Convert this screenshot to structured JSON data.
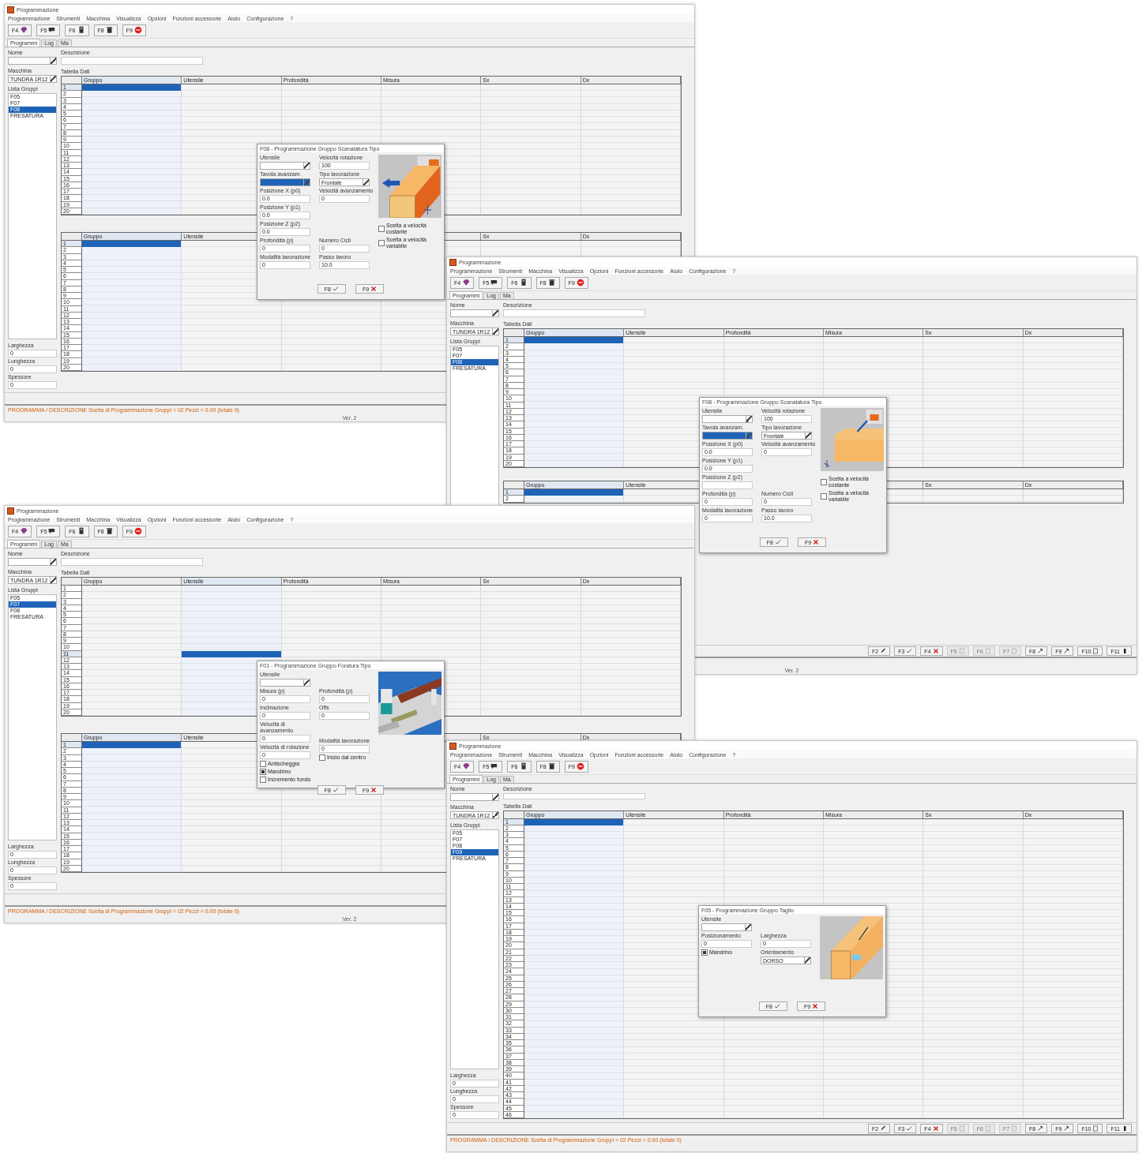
{
  "windows": [
    {
      "title": "Programmazione",
      "menu": [
        "Programmazione",
        "Strumenti",
        "Macchina",
        "Visualizza",
        "Opzioni",
        "Funzioni accessorie",
        "Aiuto",
        "Configurazione",
        "?"
      ],
      "toolbar": [
        {
          "key": "F4",
          "kind": "gem"
        },
        {
          "key": "F5",
          "kind": "chat"
        },
        {
          "key": "F6",
          "kind": "device"
        },
        {
          "key": "F8",
          "kind": "trash"
        },
        {
          "key": "F9",
          "kind": "stop"
        }
      ],
      "tabs": [
        {
          "label": "Programmi",
          "selected": true
        },
        {
          "label": "Log",
          "selected": false
        },
        {
          "label": "Ma",
          "selected": false
        }
      ],
      "name_label": "Nome",
      "description_label": "Descrizione",
      "machine_label": "Macchina",
      "machine_value": "TUNDRA 1R12",
      "groups_label": "Lista Gruppi",
      "groups": [
        {
          "label": "F05",
          "selected": false
        },
        {
          "label": "F07",
          "selected": false
        },
        {
          "label": "F08",
          "selected": true
        },
        {
          "label": "FRESATURA",
          "selected": false
        }
      ],
      "data_label": "Tabella Dati",
      "tables": [
        {
          "columns": [
            {
              "label": "Gruppo",
              "selected": true
            },
            {
              "label": "Utensile",
              "selected": false
            },
            {
              "label": "Profondità",
              "selected": false
            },
            {
              "label": "Misura",
              "selected": false
            },
            {
              "label": "Sx",
              "selected": false
            },
            {
              "label": "Dx",
              "selected": false
            }
          ],
          "rows": [
            {
              "label": "1",
              "selected": true
            },
            {
              "label": "2",
              "selected": false
            },
            {
              "label": "3",
              "selected": false
            },
            {
              "label": "4",
              "selected": false
            },
            {
              "label": "5",
              "selected": false
            },
            {
              "label": "6",
              "selected": false
            },
            {
              "label": "7",
              "selected": false
            },
            {
              "label": "8",
              "selected": false
            },
            {
              "label": "9",
              "selected": false
            },
            {
              "label": "10",
              "selected": false
            },
            {
              "label": "11",
              "selected": false
            },
            {
              "label": "12",
              "selected": false
            },
            {
              "label": "13",
              "selected": false
            },
            {
              "label": "14",
              "selected": false
            },
            {
              "label": "15",
              "selected": false
            },
            {
              "label": "16",
              "selected": false
            },
            {
              "label": "17",
              "selected": false
            },
            {
              "label": "18",
              "selected": false
            },
            {
              "label": "19",
              "selected": false
            },
            {
              "label": "20",
              "selected": false
            }
          ]
        },
        {
          "columns": [
            {
              "label": "Gruppo",
              "selected": true
            },
            {
              "label": "Utensile",
              "selected": false
            },
            {
              "selected": false
            },
            {
              "selected": false
            },
            {
              "label": "Sx",
              "selected": false
            },
            {
              "label": "Dx",
              "selected": false
            }
          ],
          "rows": [
            {
              "label": "1",
              "selected": true
            },
            {
              "label": "2",
              "selected": false
            },
            {
              "label": "3",
              "selected": false
            },
            {
              "label": "4",
              "selected": false
            },
            {
              "label": "5",
              "selected": false
            },
            {
              "label": "6",
              "selected": false
            },
            {
              "label": "7",
              "selected": false
            },
            {
              "label": "8",
              "selected": false
            },
            {
              "label": "9",
              "selected": false
            },
            {
              "label": "10",
              "selected": false
            },
            {
              "label": "11",
              "selected": false
            },
            {
              "label": "12",
              "selected": false
            },
            {
              "label": "13",
              "selected": false
            },
            {
              "label": "14",
              "selected": false
            },
            {
              "label": "15",
              "selected": false
            },
            {
              "label": "16",
              "selected": false
            },
            {
              "label": "17",
              "selected": false
            },
            {
              "label": "18",
              "selected": false
            },
            {
              "label": "19",
              "selected": false
            },
            {
              "label": "20",
              "selected": false
            }
          ]
        }
      ],
      "dimension_fields": [
        {
          "label": "Larghezza",
          "value": "0"
        },
        {
          "label": "Lunghezza",
          "value": "0"
        },
        {
          "label": "Spessore",
          "value": "0"
        }
      ],
      "status": "PROGRAMMA / DESCRIZIONE Scelta di Programmazione Gruppi = 02 Pezzi = 0.00 (totale 0)",
      "version": "Ver. 2",
      "dialog": {
        "title": "F08 - Programmazione Gruppo Scanalatura Tipo",
        "illustration": {
          "kind": "beam"
        },
        "columns": [
          [
            {
              "kind": "select",
              "label": "Utensile",
              "selected": false
            },
            {
              "kind": "select",
              "label": "Tavola avanzam.",
              "selected": true
            },
            {
              "kind": "text",
              "label": "Posizione X (p0)",
              "value": "0.0"
            },
            {
              "kind": "text",
              "label": "Posizione Y (p1)",
              "value": "0.0"
            },
            {
              "kind": "text",
              "label": "Posizione Z (p2)",
              "value": "0.0"
            },
            {
              "kind": "text",
              "label": "Profondità (p)",
              "value": "0"
            },
            {
              "kind": "text",
              "label": "Modalità lavorazione",
              "value": "0"
            }
          ],
          [
            {
              "kind": "text",
              "label": "Velocità rotazione",
              "value": "100"
            },
            {
              "kind": "select",
              "label": "Tipo lavorazione",
              "value": "Frontale",
              "selected": false
            },
            {
              "kind": "text",
              "label": "Velocità avanzamento",
              "value": "0"
            },
            {
              "kind": "blank"
            },
            {
              "kind": "blank"
            },
            {
              "kind": "text",
              "label": "Numero Cicli",
              "value": "0"
            },
            {
              "kind": "text",
              "label": "Passo lavoro",
              "value": "10.0"
            }
          ],
          [
            {
              "kind": "check",
              "label": "Scelta a velocità costante",
              "checked": false
            },
            {
              "kind": "check",
              "label": "Scelta a velocità variabile",
              "checked": false
            }
          ]
        ],
        "buttons": [
          {
            "key": "F8",
            "kind": "tick"
          },
          {
            "key": "F9",
            "kind": "cross"
          }
        ]
      }
    },
    {
      "title": "Programmazione",
      "menu": [
        "Programmazione",
        "Strumenti",
        "Macchina",
        "Visualizza",
        "Opzioni",
        "Funzioni accessorie",
        "Aiuto",
        "Configurazione",
        "?"
      ],
      "toolbar": [
        {
          "key": "F4",
          "kind": "gem"
        },
        {
          "key": "F5",
          "kind": "chat"
        },
        {
          "key": "F6",
          "kind": "device"
        },
        {
          "key": "F8",
          "kind": "trash"
        },
        {
          "key": "F9",
          "kind": "stop"
        }
      ],
      "tabs": [
        {
          "label": "Programmi",
          "selected": true
        },
        {
          "label": "Log",
          "selected": false
        },
        {
          "label": "Ma",
          "selected": false
        }
      ],
      "name_label": "Nome",
      "description_label": "Descrizione",
      "machine_label": "Macchina",
      "machine_value": "TUNDRA 1R12",
      "groups_label": "Lista Gruppi",
      "groups": [
        {
          "label": "F05",
          "selected": false
        },
        {
          "label": "F07",
          "selected": false
        },
        {
          "label": "F08",
          "selected": true
        },
        {
          "label": "FRESATURA",
          "selected": false
        }
      ],
      "data_label": "Tabella Dati",
      "tables": [
        {
          "columns": [
            {
              "label": "Gruppo",
              "selected": true
            },
            {
              "label": "Utensile",
              "selected": false
            },
            {
              "label": "Profondità",
              "selected": false
            },
            {
              "label": "Misura",
              "selected": false
            },
            {
              "label": "Sx",
              "selected": false
            },
            {
              "label": "Dx",
              "selected": false
            }
          ],
          "rows": [
            {
              "label": "1",
              "selected": true
            },
            {
              "label": "2",
              "selected": false
            },
            {
              "label": "3",
              "selected": false
            },
            {
              "label": "4",
              "selected": false
            },
            {
              "label": "5",
              "selected": false
            },
            {
              "label": "6",
              "selected": false
            },
            {
              "label": "7",
              "selected": false
            },
            {
              "label": "8",
              "selected": false
            },
            {
              "label": "9",
              "selected": false
            },
            {
              "label": "10",
              "selected": false
            },
            {
              "label": "11",
              "selected": false
            },
            {
              "label": "12",
              "selected": false
            },
            {
              "label": "13",
              "selected": false
            },
            {
              "label": "14",
              "selected": false
            },
            {
              "label": "15",
              "selected": false
            },
            {
              "label": "16",
              "selected": false
            },
            {
              "label": "17",
              "selected": false
            },
            {
              "label": "18",
              "selected": false
            },
            {
              "label": "19",
              "selected": false
            },
            {
              "label": "20",
              "selected": false
            }
          ]
        },
        {
          "columns": [
            {
              "label": "Gruppo",
              "selected": true
            },
            {
              "label": "Utensile",
              "selected": false
            },
            {},
            {
              "selected": false
            },
            {
              "label": "Sx",
              "selected": false
            },
            {
              "label": "Dx",
              "selected": false
            }
          ],
          "rows": [
            {
              "label": "1",
              "selected": true
            },
            {
              "label": "2",
              "selected": false
            }
          ]
        }
      ],
      "bottom_buttons": [
        {
          "key": "F2",
          "kind": "pen",
          "disabled": false
        },
        {
          "key": "F3",
          "kind": "tick",
          "disabled": false
        },
        {
          "key": "F4",
          "kind": "cross",
          "disabled": false
        },
        {
          "key": "F5",
          "kind": "doc",
          "disabled": true
        },
        {
          "key": "F6",
          "kind": "doc",
          "disabled": true
        },
        {
          "key": "F7",
          "kind": "doc",
          "disabled": true
        },
        {
          "key": "F8",
          "kind": "arrow",
          "disabled": false
        },
        {
          "key": "F9",
          "kind": "arrow",
          "disabled": false
        },
        {
          "key": "F10",
          "kind": "doc",
          "disabled": false
        },
        {
          "key": "F11",
          "kind": "bar",
          "disabled": false
        }
      ],
      "version": "Ver. 2",
      "dialog": {
        "title": "F08 - Programmazione Gruppo Scanalatura Tipo",
        "illustration": {
          "kind": "edge"
        },
        "columns": [
          [
            {
              "kind": "select",
              "label": "Utensile",
              "selected": false
            },
            {
              "kind": "select",
              "label": "Tavola avanzam.",
              "selected": true
            },
            {
              "kind": "text",
              "label": "Posizione X (p0)",
              "value": "0.0"
            },
            {
              "kind": "text",
              "label": "Posizione Y (p1)",
              "value": "0.0"
            },
            {
              "kind": "text",
              "label": "Posizione Z (p2)"
            },
            {
              "kind": "text",
              "label": "Profondità (p)",
              "value": "0"
            },
            {
              "kind": "text",
              "label": "Modalità lavorazione",
              "value": "0"
            }
          ],
          [
            {
              "kind": "text",
              "label": "Velocità rotazione",
              "value": "100"
            },
            {
              "kind": "select",
              "label": "Tipo lavorazione",
              "value": "Frontale",
              "selected": false
            },
            {
              "kind": "text",
              "label": "Velocità avanzamento",
              "value": "0"
            },
            {
              "kind": "blank"
            },
            {
              "kind": "blank"
            },
            {
              "kind": "text",
              "label": "Numero Cicli",
              "value": "0"
            },
            {
              "kind": "text",
              "label": "Passo lavoro",
              "value": "10.0"
            }
          ],
          [
            {
              "kind": "check",
              "label": "Scelta a velocità costante",
              "checked": false
            },
            {
              "kind": "check",
              "label": "Scelta a velocità variabile",
              "checked": false
            }
          ]
        ],
        "buttons": [
          {
            "key": "F8",
            "kind": "tick"
          },
          {
            "key": "F9",
            "kind": "cross"
          }
        ]
      }
    },
    {
      "title": "Programmazione",
      "menu": [
        "Programmazione",
        "Strumenti",
        "Macchina",
        "Visualizza",
        "Opzioni",
        "Funzioni accessorie",
        "Aiuto",
        "Configurazione",
        "?"
      ],
      "toolbar": [
        {
          "key": "F4",
          "kind": "gem"
        },
        {
          "key": "F5",
          "kind": "chat"
        },
        {
          "key": "F6",
          "kind": "device"
        },
        {
          "key": "F8",
          "kind": "trash"
        },
        {
          "key": "F9",
          "kind": "stop"
        }
      ],
      "tabs": [
        {
          "label": "Programmi",
          "selected": true
        },
        {
          "label": "Log",
          "selected": false
        },
        {
          "label": "Ma",
          "selected": false
        }
      ],
      "name_label": "Nome",
      "description_label": "Descrizione",
      "machine_label": "Macchina",
      "machine_value": "TUNDRA 1R12",
      "groups_label": "Lista Gruppi",
      "groups": [
        {
          "label": "F05",
          "selected": false
        },
        {
          "label": "F07",
          "selected": true
        },
        {
          "label": "F08",
          "selected": false
        },
        {
          "label": "FRESATURA",
          "selected": false
        }
      ],
      "data_label": "Tabella Dati",
      "tables": [
        {
          "columns": [
            {
              "label": "Gruppo",
              "selected": false
            },
            {
              "label": "Utensile",
              "selected": true
            },
            {
              "label": "Profondità",
              "selected": false
            },
            {
              "label": "Misura",
              "selected": false
            },
            {
              "label": "Sx",
              "selected": false
            },
            {
              "label": "Dx",
              "selected": false
            }
          ],
          "rows": [
            {
              "label": "1",
              "selected": false
            },
            {
              "label": "2",
              "selected": false
            },
            {
              "label": "3",
              "selected": false
            },
            {
              "label": "4",
              "selected": false
            },
            {
              "label": "5",
              "selected": false
            },
            {
              "label": "6",
              "selected": false
            },
            {
              "label": "7",
              "selected": false
            },
            {
              "label": "8",
              "selected": false
            },
            {
              "label": "9",
              "selected": false
            },
            {
              "label": "10",
              "selected": false
            },
            {
              "label": "11",
              "selected": true
            },
            {
              "label": "12",
              "selected": false
            },
            {
              "label": "13",
              "selected": false
            },
            {
              "label": "14",
              "selected": false
            },
            {
              "label": "15",
              "selected": false
            },
            {
              "label": "16",
              "selected": false
            },
            {
              "label": "17",
              "selected": false
            },
            {
              "label": "18",
              "selected": false
            },
            {
              "label": "19",
              "selected": false
            },
            {
              "label": "20",
              "selected": false
            }
          ]
        },
        {
          "columns": [
            {
              "label": "Gruppo",
              "selected": true
            },
            {
              "label": "Utensile",
              "selected": false
            },
            {
              "selected": false
            },
            {
              "selected": false
            },
            {
              "label": "Sx"
            },
            {
              "label": "Dx"
            }
          ],
          "rows": [
            {
              "label": "1",
              "selected": true
            },
            {
              "label": "2",
              "selected": false
            },
            {
              "label": "3",
              "selected": false
            },
            {
              "label": "4",
              "selected": false
            },
            {
              "label": "5",
              "selected": false
            },
            {
              "label": "6",
              "selected": false
            },
            {
              "label": "7",
              "selected": false
            },
            {
              "label": "8",
              "selected": false
            },
            {
              "label": "9",
              "selected": false
            },
            {
              "label": "10",
              "selected": false
            },
            {
              "label": "11",
              "selected": false
            },
            {
              "label": "12",
              "selected": false
            },
            {
              "label": "13",
              "selected": false
            },
            {
              "label": "14",
              "selected": false
            },
            {
              "label": "15",
              "selected": false
            },
            {
              "label": "16",
              "selected": false
            },
            {
              "label": "17",
              "selected": false
            },
            {
              "label": "18",
              "selected": false
            },
            {
              "label": "19",
              "selected": false
            },
            {
              "label": "20",
              "selected": false
            }
          ]
        }
      ],
      "dimension_fields": [
        {
          "label": "Larghezza",
          "value": "0"
        },
        {
          "label": "Lunghezza",
          "value": "0"
        },
        {
          "label": "Spessore",
          "value": "0"
        }
      ],
      "status": "PROGRAMMA / DESCRIZIONE Scelta di Programmazione Gruppi = 02 Pezzi = 0.00 (totale 0)",
      "version": "Ver. 2",
      "dialog": {
        "title": "F01 - Programmazione Gruppo Foratura Tipo",
        "illustration": {
          "kind": "machine"
        },
        "columns": [
          [
            {
              "kind": "select",
              "label": "Utensile",
              "selected": false
            },
            {
              "kind": "text",
              "label": "Misura (p)",
              "value": "0"
            },
            {
              "kind": "text",
              "label": "Inclinazione",
              "value": "0"
            },
            {
              "kind": "text",
              "label": "Velocità di avanzamento",
              "value": "0"
            },
            {
              "kind": "text",
              "label": "Velocità di rotazione",
              "value": "0"
            },
            {
              "kind": "check",
              "label": "Antischeggia",
              "checked": false
            },
            {
              "kind": "check",
              "label": "Mandrino",
              "checked": true
            },
            {
              "kind": "check",
              "label": "Incremento fondo",
              "checked": false
            }
          ],
          [
            {
              "kind": "blank"
            },
            {
              "kind": "text",
              "label": "Profondità (p)",
              "value": "0"
            },
            {
              "kind": "text",
              "label": "Offs",
              "value": "0"
            },
            {
              "kind": "blank"
            },
            {
              "kind": "text",
              "label": "Modalità lavorazione",
              "value": "0"
            },
            {
              "kind": "check",
              "label": "Inizio dal centro",
              "checked": false
            }
          ],
          []
        ],
        "buttons": [
          {
            "key": "F8",
            "kind": "tick"
          },
          {
            "key": "F9",
            "kind": "cross"
          }
        ]
      }
    },
    {
      "title": "Programmazione",
      "menu": [
        "Programmazione",
        "Strumenti",
        "Macchina",
        "Visualizza",
        "Opzioni",
        "Funzioni accessorie",
        "Aiuto",
        "Configurazione",
        "?"
      ],
      "toolbar": [
        {
          "key": "F4",
          "kind": "gem"
        },
        {
          "key": "F5",
          "kind": "chat"
        },
        {
          "key": "F6",
          "kind": "device"
        },
        {
          "key": "F8",
          "kind": "trash"
        },
        {
          "key": "F9",
          "kind": "stop"
        }
      ],
      "tabs": [
        {
          "label": "Programmi",
          "selected": true
        },
        {
          "label": "Log",
          "selected": false
        },
        {
          "label": "Ma",
          "selected": false
        }
      ],
      "name_label": "Nome",
      "description_label": "Descrizione",
      "machine_label": "Macchina",
      "machine_value": "TUNDRA 1R12",
      "groups_label": "Lista Gruppi",
      "groups": [
        {
          "label": "F05",
          "selected": false
        },
        {
          "label": "F07",
          "selected": false
        },
        {
          "label": "F08",
          "selected": false
        },
        {
          "label": "F09",
          "selected": true
        },
        {
          "label": "FRESATURA",
          "selected": false
        }
      ],
      "data_label": "Tabella Dati",
      "tables": [
        {
          "columns": [
            {
              "label": "Gruppo",
              "selected": true
            },
            {
              "label": "Utensile",
              "selected": false
            },
            {
              "label": "Profondità",
              "selected": false
            },
            {
              "label": "Misura",
              "selected": false
            },
            {
              "label": "Sx",
              "selected": false
            },
            {
              "label": "Dx",
              "selected": false
            }
          ],
          "rows": [
            {
              "label": "1",
              "selected": true
            },
            {
              "label": "2",
              "selected": false
            },
            {
              "label": "3",
              "selected": false
            },
            {
              "label": "4",
              "selected": false
            },
            {
              "label": "5",
              "selected": false
            },
            {
              "label": "6",
              "selected": false
            },
            {
              "label": "7",
              "selected": false
            },
            {
              "label": "8",
              "selected": false
            },
            {
              "label": "9",
              "selected": false
            },
            {
              "label": "10",
              "selected": false
            },
            {
              "label": "11",
              "selected": false
            },
            {
              "label": "12",
              "selected": false
            },
            {
              "label": "13",
              "selected": false
            },
            {
              "label": "14",
              "selected": false
            },
            {
              "label": "15",
              "selected": false
            },
            {
              "label": "16",
              "selected": false
            },
            {
              "label": "17",
              "selected": false
            },
            {
              "label": "18",
              "selected": false
            },
            {
              "label": "19",
              "selected": false
            },
            {
              "label": "20",
              "selected": false
            },
            {
              "label": "21",
              "selected": false
            },
            {
              "label": "22",
              "selected": false
            },
            {
              "label": "23",
              "selected": false
            },
            {
              "label": "24",
              "selected": false
            },
            {
              "label": "25",
              "selected": false
            },
            {
              "label": "26",
              "selected": false
            },
            {
              "label": "27",
              "selected": false
            },
            {
              "label": "28",
              "selected": false
            },
            {
              "label": "29",
              "selected": false
            },
            {
              "label": "30",
              "selected": false
            },
            {
              "label": "31",
              "selected": false
            },
            {
              "label": "32",
              "selected": false
            },
            {
              "label": "33",
              "selected": false
            },
            {
              "label": "34",
              "selected": false
            },
            {
              "label": "35",
              "selected": false
            },
            {
              "label": "36",
              "selected": false
            },
            {
              "label": "37",
              "selected": false
            },
            {
              "label": "38",
              "selected": false
            },
            {
              "label": "39",
              "selected": false
            },
            {
              "label": "40",
              "selected": false
            },
            {
              "label": "41",
              "selected": false
            },
            {
              "label": "42",
              "selected": false
            },
            {
              "label": "43",
              "selected": false
            },
            {
              "label": "44",
              "selected": false
            },
            {
              "label": "45",
              "selected": false
            },
            {
              "label": "46",
              "selected": false
            }
          ]
        }
      ],
      "dimension_fields": [
        {
          "label": "Larghezza",
          "value": "0"
        },
        {
          "label": "Lunghezza",
          "value": "0"
        },
        {
          "label": "Spessore",
          "value": "0"
        }
      ],
      "bottom_buttons": [
        {
          "key": "F2",
          "kind": "pen",
          "disabled": false
        },
        {
          "key": "F3",
          "kind": "tick",
          "disabled": false
        },
        {
          "key": "F4",
          "kind": "cross",
          "disabled": false
        },
        {
          "key": "F5",
          "kind": "doc",
          "disabled": true
        },
        {
          "key": "F6",
          "kind": "doc",
          "disabled": true
        },
        {
          "key": "F7",
          "kind": "doc",
          "disabled": true
        },
        {
          "key": "F8",
          "kind": "arrow",
          "disabled": false
        },
        {
          "key": "F9",
          "kind": "arrow",
          "disabled": false
        },
        {
          "key": "F10",
          "kind": "doc",
          "disabled": false
        },
        {
          "key": "F11",
          "kind": "bar",
          "disabled": false
        }
      ],
      "status": "PROGRAMMA / DESCRIZIONE Scelta di Programmazione Gruppi = 02 Pezzi = 0.00 (totale 0)",
      "dialog": {
        "title": "F05 - Programmazione Gruppo Taglio",
        "illustration": {
          "kind": "profile"
        },
        "columns": [
          [
            {
              "kind": "select",
              "label": "Utensile",
              "selected": false
            },
            {
              "kind": "text",
              "label": "Posizionamento",
              "value": "0"
            },
            {
              "kind": "check",
              "label": "Mandrino",
              "checked": true
            }
          ],
          [
            {
              "kind": "blank"
            },
            {
              "kind": "text",
              "label": "Larghezza",
              "value": "0"
            },
            {
              "kind": "select",
              "label": "Orientamento",
              "value": "DORSO",
              "selected": false
            }
          ],
          []
        ],
        "buttons": [
          {
            "key": "F8",
            "kind": "tick"
          },
          {
            "key": "F9",
            "kind": "cross"
          }
        ]
      }
    }
  ]
}
